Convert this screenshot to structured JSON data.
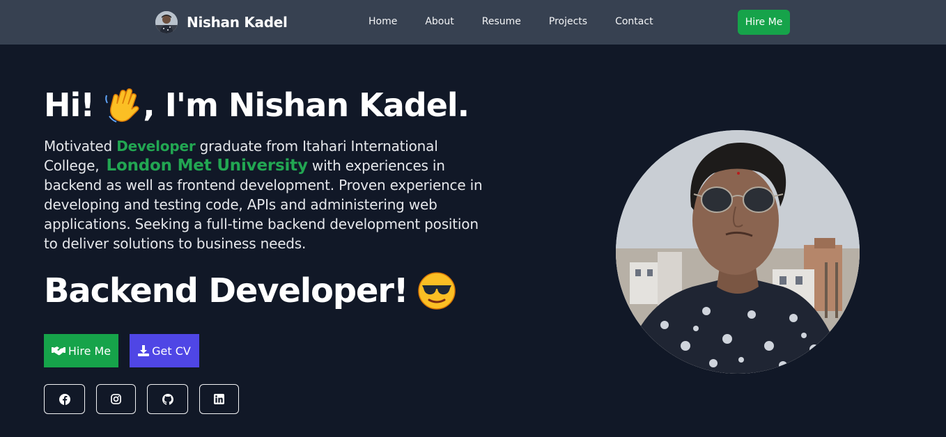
{
  "navbar": {
    "brand_name": "Nishan Kadel",
    "links": [
      "Home",
      "About",
      "Resume",
      "Projects",
      "Contact"
    ],
    "hire_label": "Hire Me"
  },
  "hero": {
    "greeting_prefix": "Hi!",
    "greeting_suffix": ", I'm Nishan Kadel.",
    "intro_part1": "Motivated ",
    "intro_highlight1": "Developer",
    "intro_part2": " graduate from Itahari International College, ",
    "intro_highlight2": "London Met University",
    "intro_part3": " with experiences in backend as well as frontend development. Proven experience in developing and testing code, APIs and administering web applications. Seeking a full-time backend development position to deliver solutions to business needs.",
    "role_title": "Backend Developer!",
    "hire_button_label": "Hire Me",
    "cv_button_label": "Get CV"
  },
  "social": [
    {
      "icon": "facebook-icon"
    },
    {
      "icon": "instagram-icon"
    },
    {
      "icon": "github-icon"
    },
    {
      "icon": "linkedin-icon"
    }
  ],
  "colors": {
    "background": "#111827",
    "navbar": "#374151",
    "accent_green": "#16a34a",
    "accent_indigo": "#4f46e5"
  }
}
